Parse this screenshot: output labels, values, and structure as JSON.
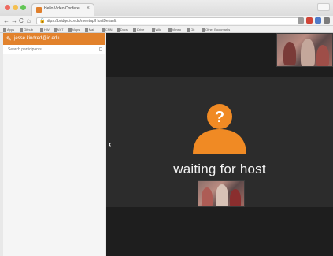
{
  "browser": {
    "tab_title": "Hello Video Confere...",
    "tab_close": "×",
    "url": "https://bridge.ic.edu/meetup/HostDefault",
    "nav": {
      "back": "←",
      "forward": "→",
      "reload": "C",
      "home": "⌂"
    },
    "bookmarks": [
      "Apps",
      "Github",
      "HW",
      "NYT",
      "Maps",
      "Mail",
      "CNN",
      "Docs",
      "Drive",
      "Wiki",
      "Vimeo",
      "Git",
      "Other Bookmarks"
    ]
  },
  "sidebar": {
    "email": "jesse.kindred@ic.edu",
    "search_placeholder": "Search participants..."
  },
  "stage": {
    "collapse_glyph": "‹",
    "status_text": "waiting for host",
    "avatar_glyph": "?"
  },
  "colors": {
    "accent": "#e2822c",
    "stage_bg": "#1e1e1e",
    "stage_band": "#2c2c2c"
  }
}
